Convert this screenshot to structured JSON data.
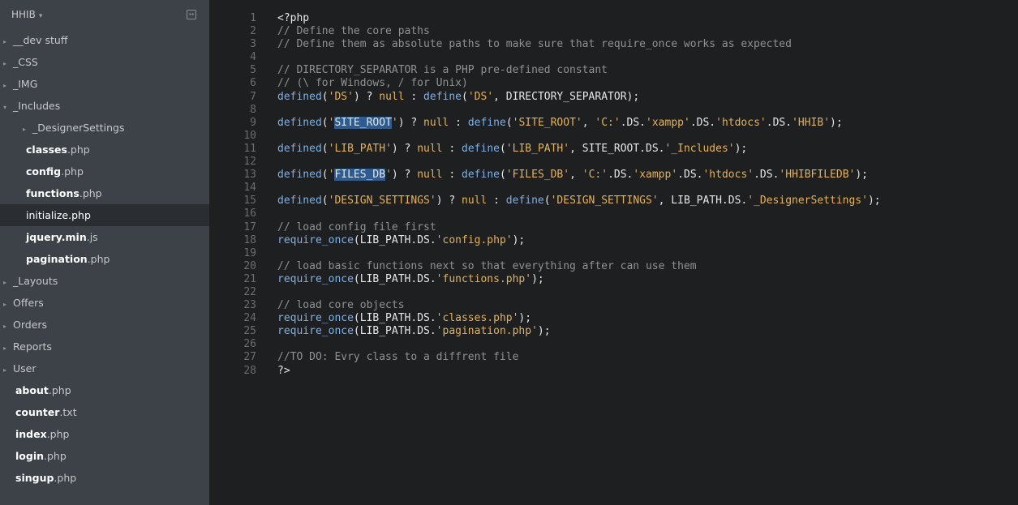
{
  "sidebar": {
    "title": "HHIB",
    "title_caret": "▾",
    "collapse_icon": "collapse-icon",
    "items": [
      {
        "type": "folder",
        "label": "__dev stuff",
        "expanded": false
      },
      {
        "type": "folder",
        "label": "_CSS",
        "expanded": false
      },
      {
        "type": "folder",
        "label": "_IMG",
        "expanded": false
      },
      {
        "type": "folder",
        "label": "_Includes",
        "expanded": true
      },
      {
        "type": "nested-folder",
        "label": "_DesignerSettings",
        "expanded": false
      },
      {
        "type": "nested-file",
        "name": "classes",
        "ext": ".php"
      },
      {
        "type": "nested-file",
        "name": "config",
        "ext": ".php"
      },
      {
        "type": "nested-file",
        "name": "functions",
        "ext": ".php"
      },
      {
        "type": "nested-file",
        "name": "initialize",
        "ext": ".php",
        "active": true
      },
      {
        "type": "nested-file",
        "name": "jquery.min",
        "ext": ".js"
      },
      {
        "type": "nested-file",
        "name": "pagination",
        "ext": ".php"
      },
      {
        "type": "folder",
        "label": "_Layouts",
        "expanded": false
      },
      {
        "type": "folder",
        "label": "Offers",
        "expanded": false
      },
      {
        "type": "folder",
        "label": "Orders",
        "expanded": false
      },
      {
        "type": "folder",
        "label": "Reports",
        "expanded": false
      },
      {
        "type": "folder",
        "label": "User",
        "expanded": false
      },
      {
        "type": "file",
        "name": "about",
        "ext": ".php"
      },
      {
        "type": "file",
        "name": "counter",
        "ext": ".txt"
      },
      {
        "type": "file",
        "name": "index",
        "ext": ".php"
      },
      {
        "type": "file",
        "name": "login",
        "ext": ".php"
      },
      {
        "type": "file",
        "name": "singup",
        "ext": ".php"
      }
    ]
  },
  "editor": {
    "lines": [
      [
        [
          "plain",
          "<?php"
        ]
      ],
      [
        [
          "cm",
          "// Define the core paths"
        ]
      ],
      [
        [
          "cm",
          "// Define them as absolute paths to make sure that require_once works as expected"
        ]
      ],
      [],
      [
        [
          "cm",
          "// DIRECTORY_SEPARATOR is a PHP pre-defined constant"
        ]
      ],
      [
        [
          "cm",
          "// (\\ for Windows, / for Unix)"
        ]
      ],
      [
        [
          "fn",
          "defined"
        ],
        [
          "plain",
          "("
        ],
        [
          "str",
          "'DS'"
        ],
        [
          "plain",
          ") ? "
        ],
        [
          "kw",
          "null"
        ],
        [
          "plain",
          " : "
        ],
        [
          "fn",
          "define"
        ],
        [
          "plain",
          "("
        ],
        [
          "str",
          "'DS'"
        ],
        [
          "plain",
          ", DIRECTORY_SEPARATOR);"
        ]
      ],
      [],
      [
        [
          "fn",
          "defined"
        ],
        [
          "plain",
          "("
        ],
        [
          "str",
          "'"
        ],
        [
          "sel",
          "SITE_ROOT"
        ],
        [
          "str",
          "'"
        ],
        [
          "plain",
          ") ? "
        ],
        [
          "kw",
          "null"
        ],
        [
          "plain",
          " : "
        ],
        [
          "fn",
          "define"
        ],
        [
          "plain",
          "("
        ],
        [
          "str",
          "'SITE_ROOT'"
        ],
        [
          "plain",
          ", "
        ],
        [
          "str",
          "'C:'"
        ],
        [
          "plain",
          ".DS."
        ],
        [
          "str",
          "'xampp'"
        ],
        [
          "plain",
          ".DS."
        ],
        [
          "str",
          "'htdocs'"
        ],
        [
          "plain",
          ".DS."
        ],
        [
          "str",
          "'HHIB'"
        ],
        [
          "plain",
          ");"
        ]
      ],
      [],
      [
        [
          "fn",
          "defined"
        ],
        [
          "plain",
          "("
        ],
        [
          "str",
          "'LIB_PATH'"
        ],
        [
          "plain",
          ") ? "
        ],
        [
          "kw",
          "null"
        ],
        [
          "plain",
          " : "
        ],
        [
          "fn",
          "define"
        ],
        [
          "plain",
          "("
        ],
        [
          "str",
          "'LIB_PATH'"
        ],
        [
          "plain",
          ", SITE_ROOT.DS."
        ],
        [
          "str",
          "'_Includes'"
        ],
        [
          "plain",
          ");"
        ]
      ],
      [],
      [
        [
          "fn",
          "defined"
        ],
        [
          "plain",
          "("
        ],
        [
          "str",
          "'"
        ],
        [
          "sel",
          "FILES_DB"
        ],
        [
          "str",
          "'"
        ],
        [
          "plain",
          ") ? "
        ],
        [
          "kw",
          "null"
        ],
        [
          "plain",
          " : "
        ],
        [
          "fn",
          "define"
        ],
        [
          "plain",
          "("
        ],
        [
          "str",
          "'FILES_DB'"
        ],
        [
          "plain",
          ", "
        ],
        [
          "str",
          "'C:'"
        ],
        [
          "plain",
          ".DS."
        ],
        [
          "str",
          "'xampp'"
        ],
        [
          "plain",
          ".DS."
        ],
        [
          "str",
          "'htdocs'"
        ],
        [
          "plain",
          ".DS."
        ],
        [
          "str",
          "'HHIBFILEDB'"
        ],
        [
          "plain",
          ");"
        ]
      ],
      [],
      [
        [
          "fn",
          "defined"
        ],
        [
          "plain",
          "("
        ],
        [
          "str",
          "'DESIGN_SETTINGS'"
        ],
        [
          "plain",
          ") ? "
        ],
        [
          "kw",
          "null"
        ],
        [
          "plain",
          " : "
        ],
        [
          "fn",
          "define"
        ],
        [
          "plain",
          "("
        ],
        [
          "str",
          "'DESIGN_SETTINGS'"
        ],
        [
          "plain",
          ", LIB_PATH.DS."
        ],
        [
          "str",
          "'_DesignerSettings'"
        ],
        [
          "plain",
          ");"
        ]
      ],
      [],
      [
        [
          "cm",
          "// load config file first"
        ]
      ],
      [
        [
          "fn",
          "require_once"
        ],
        [
          "plain",
          "(LIB_PATH.DS."
        ],
        [
          "str",
          "'config.php'"
        ],
        [
          "plain",
          ");"
        ]
      ],
      [],
      [
        [
          "cm",
          "// load basic functions next so that everything after can use them"
        ]
      ],
      [
        [
          "fn",
          "require_once"
        ],
        [
          "plain",
          "(LIB_PATH.DS."
        ],
        [
          "str",
          "'functions.php'"
        ],
        [
          "plain",
          ");"
        ]
      ],
      [],
      [
        [
          "cm",
          "// load core objects"
        ]
      ],
      [
        [
          "fn",
          "require_once"
        ],
        [
          "plain",
          "(LIB_PATH.DS."
        ],
        [
          "str",
          "'classes.php'"
        ],
        [
          "plain",
          ");"
        ]
      ],
      [
        [
          "fn",
          "require_once"
        ],
        [
          "plain",
          "(LIB_PATH.DS."
        ],
        [
          "str",
          "'pagination.php'"
        ],
        [
          "plain",
          ");"
        ]
      ],
      [],
      [
        [
          "cm",
          "//TO DO: Evry class to a diffrent file"
        ]
      ],
      [
        [
          "plain",
          "?>"
        ]
      ]
    ],
    "colors": {
      "background": "#1d1f21",
      "comment": "#8f9295",
      "function": "#80b0e6",
      "string": "#e6b350",
      "selection": "#2d5c93"
    }
  }
}
